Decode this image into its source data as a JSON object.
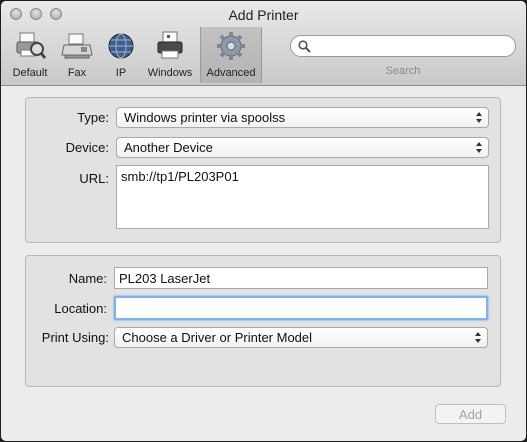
{
  "window": {
    "title": "Add Printer"
  },
  "toolbar": {
    "items": [
      {
        "label": "Default",
        "icon": "default-printer-icon"
      },
      {
        "label": "Fax",
        "icon": "fax-icon"
      },
      {
        "label": "IP",
        "icon": "globe-icon"
      },
      {
        "label": "Windows",
        "icon": "windows-printer-icon"
      },
      {
        "label": "Advanced",
        "icon": "gear-icon",
        "selected": true
      }
    ],
    "search": {
      "caption": "Search",
      "value": "",
      "placeholder": ""
    }
  },
  "connection": {
    "type_label": "Type:",
    "type_value": "Windows printer via spoolss",
    "device_label": "Device:",
    "device_value": "Another Device",
    "url_label": "URL:",
    "url_value": "smb://tp1/PL203P01"
  },
  "details": {
    "name_label": "Name:",
    "name_value": "PL203 LaserJet",
    "location_label": "Location:",
    "location_value": "",
    "print_using_label": "Print Using:",
    "print_using_value": "Choose a Driver or Printer Model"
  },
  "footer": {
    "add_label": "Add"
  },
  "colors": {
    "focus_ring": "#7fb1ea",
    "window_bg": "#ececec",
    "group_bg": "#e2e2e2"
  }
}
